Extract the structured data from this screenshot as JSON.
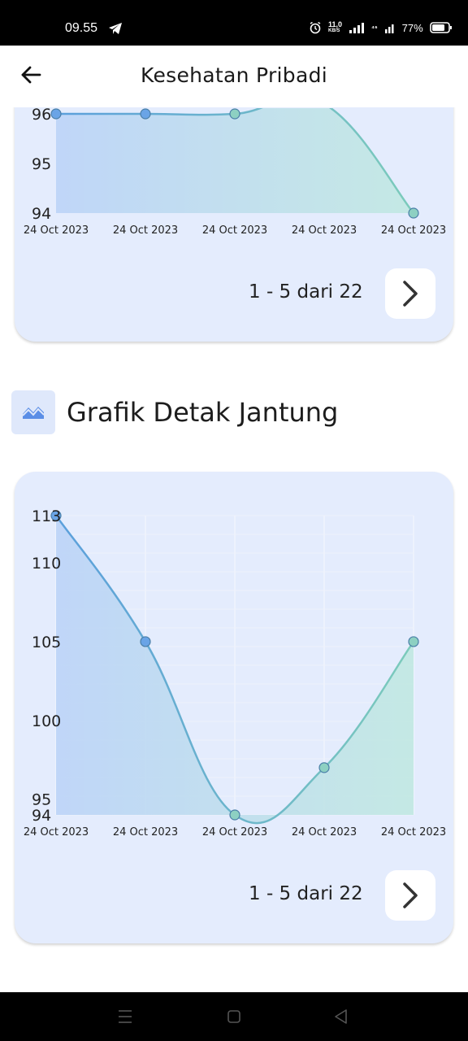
{
  "status_bar": {
    "time": "09.55",
    "speed_value": "11,0",
    "speed_unit": "KB/S",
    "network": "⁴⁶",
    "battery": "77%"
  },
  "header": {
    "title": "Kesehatan Pribadi"
  },
  "charts_meta": {
    "top": {
      "pager": "1 - 5 dari 22"
    },
    "heart": {
      "section_title": "Grafik Detak Jantung",
      "pager": "1 - 5 dari 22"
    }
  },
  "colors": {
    "card": "#e4ecfd",
    "line_start": "#5b9fdc",
    "line_end": "#7ccbbb",
    "fill_start": "#b9d2f7",
    "fill_end": "#bfe8e0"
  },
  "chart_data": [
    {
      "type": "area",
      "categories": [
        "24 Oct 2023",
        "24 Oct 2023",
        "24 Oct 2023",
        "24 Oct 2023",
        "24 Oct 2023"
      ],
      "values": [
        96,
        96,
        96,
        96.2,
        94
      ],
      "y_ticks": [
        94,
        95,
        96
      ],
      "ylim": [
        94,
        96
      ],
      "grid": false
    },
    {
      "type": "area",
      "categories": [
        "24 Oct 2023",
        "24 Oct 2023",
        "24 Oct 2023",
        "24 Oct 2023",
        "24 Oct 2023"
      ],
      "values": [
        113,
        105,
        94,
        97,
        105
      ],
      "y_ticks": [
        94,
        95,
        100,
        105,
        110,
        113
      ],
      "ylim": [
        94,
        113
      ],
      "grid": true
    }
  ]
}
